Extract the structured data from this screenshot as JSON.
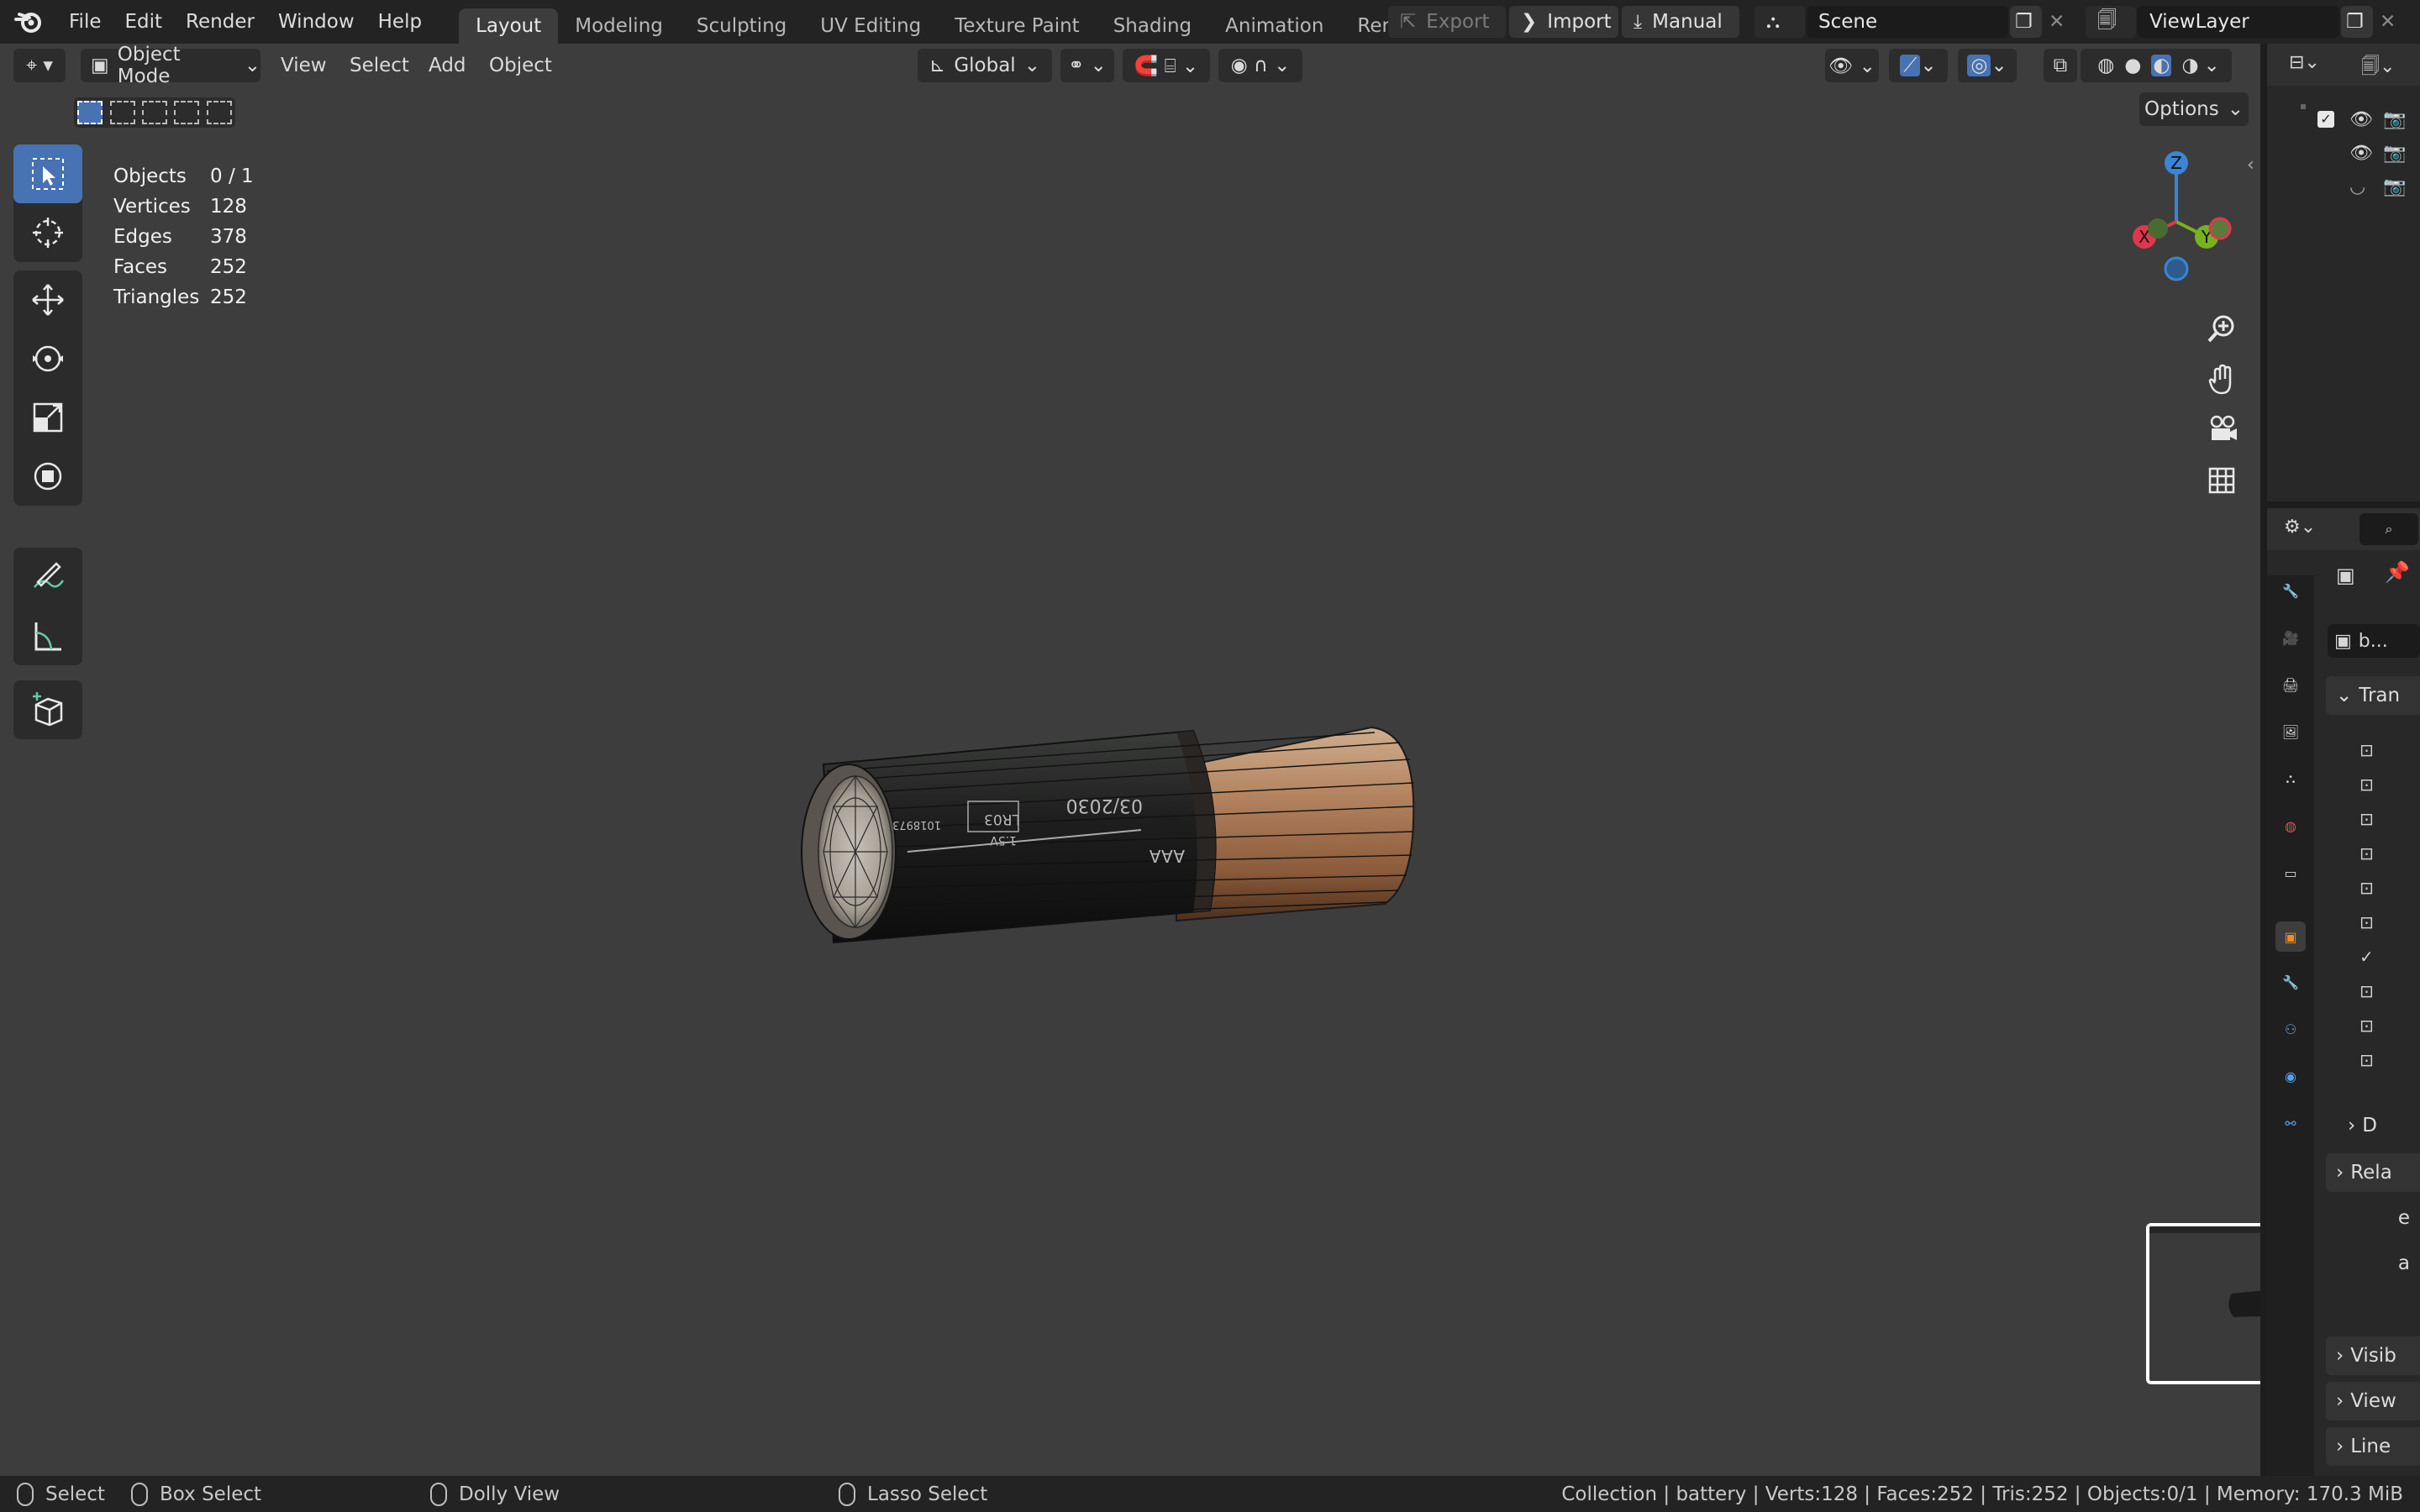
{
  "topbar": {
    "menus": [
      "File",
      "Edit",
      "Render",
      "Window",
      "Help"
    ],
    "workspaces": [
      "Layout",
      "Modeling",
      "Sculpting",
      "UV Editing",
      "Texture Paint",
      "Shading",
      "Animation",
      "Rendering"
    ],
    "active_workspace": "Layout",
    "export_label": "Export",
    "import_label": "Import",
    "manual_label": "Manual",
    "scene_name": "Scene",
    "view_layer": "ViewLayer"
  },
  "viewport_header": {
    "mode": "Object Mode",
    "menus": [
      "View",
      "Select",
      "Add",
      "Object"
    ],
    "orientation": "Global",
    "options_label": "Options"
  },
  "stats": [
    {
      "label": "Objects",
      "value": "0 / 1"
    },
    {
      "label": "Vertices",
      "value": "128"
    },
    {
      "label": "Edges",
      "value": "378"
    },
    {
      "label": "Faces",
      "value": "252"
    },
    {
      "label": "Triangles",
      "value": "252"
    }
  ],
  "gizmo": {
    "x": "X",
    "y": "Y",
    "z": "Z"
  },
  "battery_label": {
    "date": "03/2030",
    "type": "LR03",
    "voltage": "1.5V",
    "size": "AAA",
    "code": "1018973"
  },
  "properties": {
    "object_name": "b...",
    "panels": [
      "Tran",
      "D",
      "Rela",
      "e",
      "a",
      "Visib",
      "View",
      "Line"
    ]
  },
  "statusbar": {
    "select": "Select",
    "box_select": "Box Select",
    "dolly_view": "Dolly View",
    "lasso_select": "Lasso Select",
    "info": "Collection | battery | Verts:128 | Faces:252 | Tris:252 | Objects:0/1 | Memory: 170.3 MiB"
  },
  "colors": {
    "accent": "#4772b3",
    "x_axis": "#e0374f",
    "y_axis": "#77b31e",
    "z_axis": "#3a85d6",
    "viewport_bg": "#3d3d3d"
  }
}
